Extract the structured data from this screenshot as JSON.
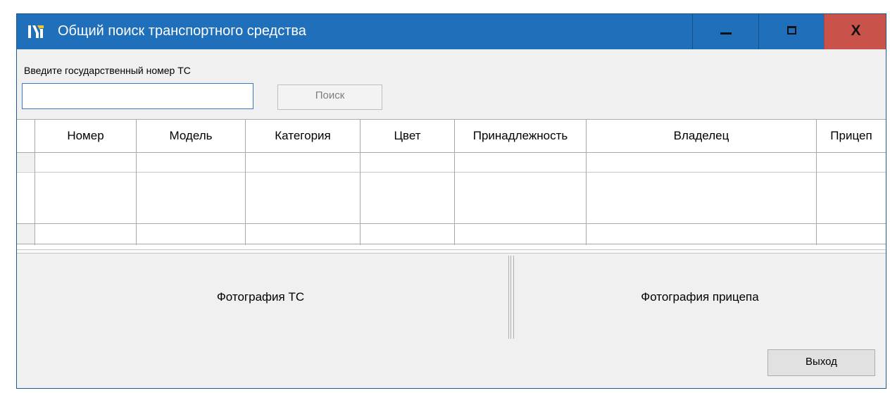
{
  "window": {
    "title": "Общий поиск транспортного средства",
    "close_glyph": "X",
    "accent_color": "#1f6fbb",
    "close_color": "#c9534a"
  },
  "search": {
    "label": "Введите государственный номер ТС",
    "value": "",
    "button_label": "Поиск"
  },
  "table": {
    "columns": [
      "Номер",
      "Модель",
      "Категория",
      "Цвет",
      "Принадлежность",
      "Владелец",
      "Прицеп"
    ],
    "rows": []
  },
  "photos": {
    "vehicle_label": "Фотография ТС",
    "trailer_label": "Фотография прицепа"
  },
  "footer": {
    "exit_label": "Выход"
  }
}
